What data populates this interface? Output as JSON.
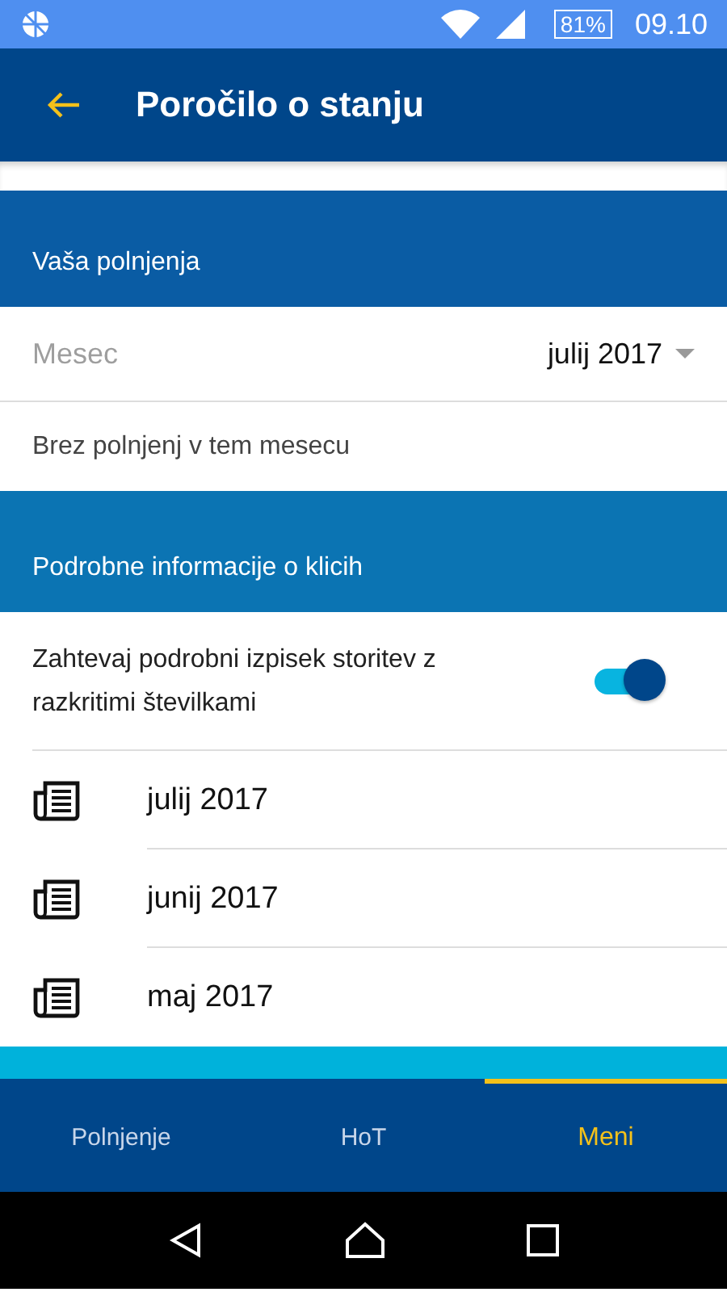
{
  "status_bar": {
    "battery": "81%",
    "time": "09.10"
  },
  "app_bar": {
    "title": "Poročilo o stanju"
  },
  "charges_section": {
    "title": "Vaša polnjenja",
    "month_label": "Mesec",
    "month_value": "julij 2017",
    "empty_message": "Brez polnjenj v tem mesecu"
  },
  "calls_section": {
    "title": "Podrobne informacije o klicih",
    "toggle_label": "Zahtevaj podrobni izpisek storitev z razkritimi številkami",
    "toggle_on": true,
    "statements": [
      {
        "label": "julij 2017"
      },
      {
        "label": "junij 2017"
      },
      {
        "label": "maj 2017"
      }
    ]
  },
  "bottom_nav": [
    {
      "label": "Polnjenje",
      "selected": false
    },
    {
      "label": "HoT",
      "selected": false
    },
    {
      "label": "Meni",
      "selected": true
    }
  ]
}
